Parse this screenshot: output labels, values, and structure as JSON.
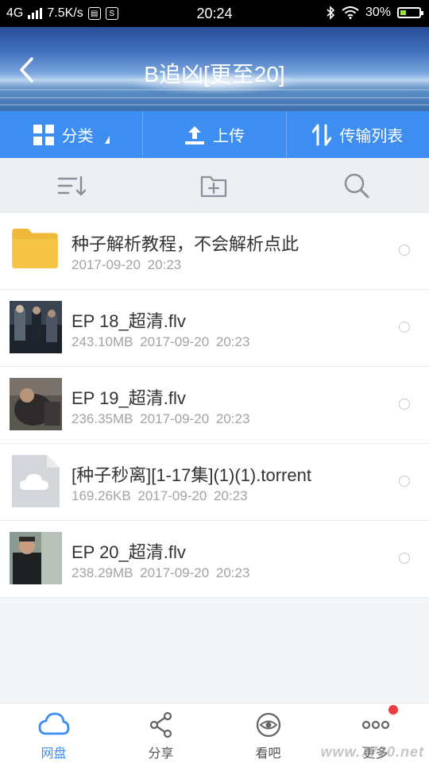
{
  "status_bar": {
    "network": "4G",
    "speed": "7.5K/s",
    "app_badge": "S",
    "time": "20:24",
    "battery": "30%",
    "battery_level": 0.3
  },
  "header": {
    "title": "B追凶[更至20]"
  },
  "actions": {
    "category_label": "分类",
    "upload_label": "上传",
    "transfer_label": "传输列表"
  },
  "files": [
    {
      "type": "folder",
      "name": "种子解析教程，不会解析点此",
      "meta": "2017-09-20 20:23"
    },
    {
      "type": "video",
      "name": "EP 18_超清.flv",
      "meta": "243.10MB 2017-09-20 20:23"
    },
    {
      "type": "video",
      "name": "EP 19_超清.flv",
      "meta": "236.35MB 2017-09-20 20:23"
    },
    {
      "type": "torrent",
      "name": "[种子秒离][1-17集](1)(1).torrent",
      "meta": "169.26KB 2017-09-20 20:23"
    },
    {
      "type": "video",
      "name": "EP 20_超清.flv",
      "meta": "238.29MB 2017-09-20 20:23"
    }
  ],
  "bottom_nav": [
    {
      "label": "网盘",
      "icon": "cloud-icon",
      "active": true
    },
    {
      "label": "分享",
      "icon": "share-icon",
      "active": false
    },
    {
      "label": "看吧",
      "icon": "eye-icon",
      "active": false
    },
    {
      "label": "更多",
      "icon": "more-icon",
      "active": false
    }
  ],
  "watermark": "www.7730.net",
  "colors": {
    "accent": "#3d8ef0",
    "folder": "#f6c445",
    "notification_dot": "#ee3b3b"
  }
}
